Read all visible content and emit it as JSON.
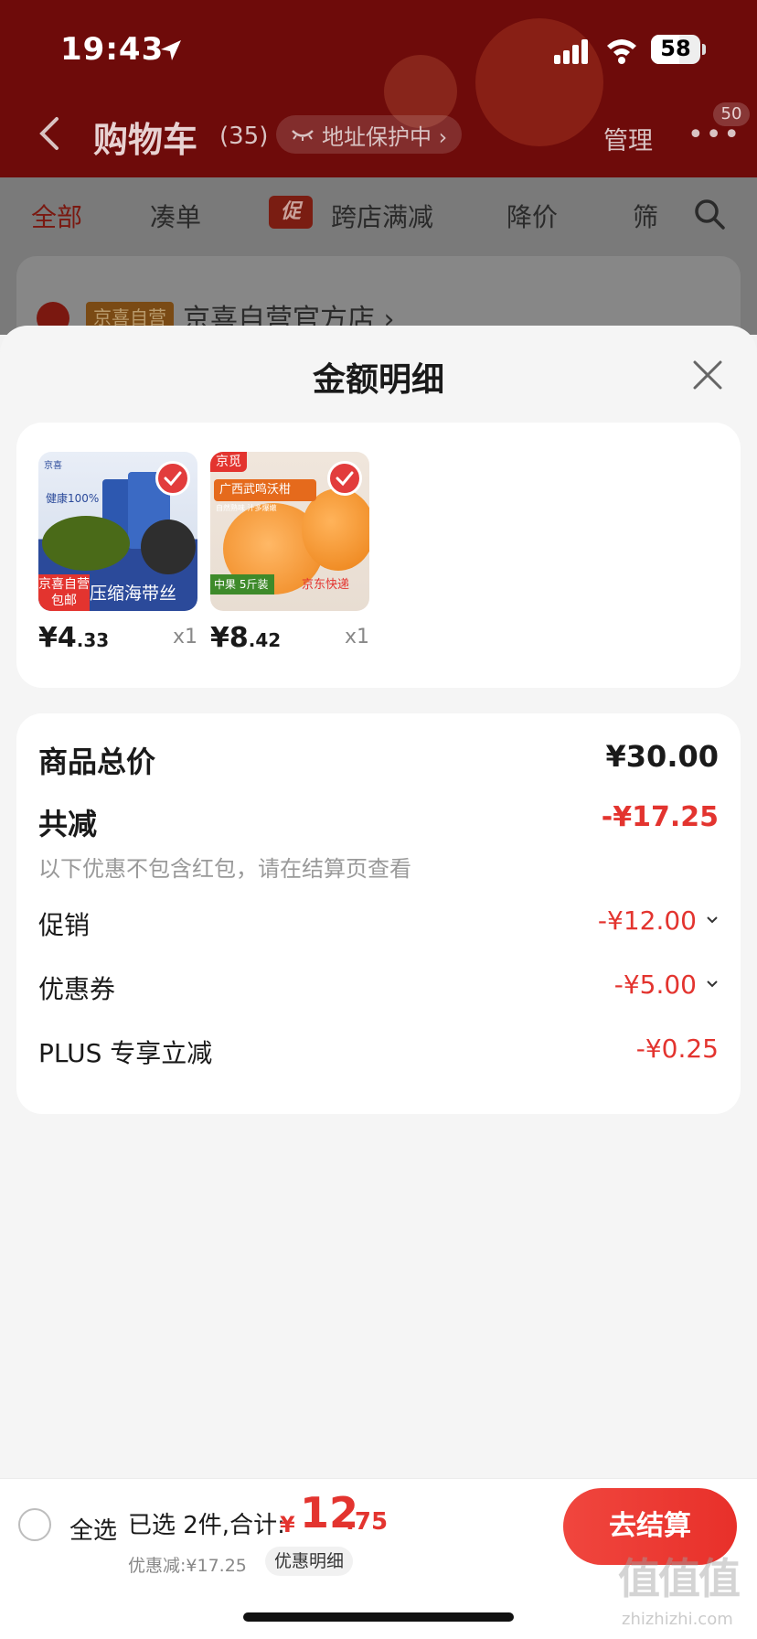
{
  "status_bar": {
    "time": "19:43",
    "battery": "58"
  },
  "nav": {
    "title": "购物车",
    "count": "(35)",
    "address_pill": "地址保护中 ›",
    "manage": "管理",
    "more": "•••",
    "badge": "50"
  },
  "tabs": [
    {
      "label": "全部"
    },
    {
      "label": "凑单"
    },
    {
      "label": "跨店满减",
      "tag": "促"
    },
    {
      "label": "降价"
    },
    {
      "label": "筛"
    }
  ],
  "store": {
    "tag": "京喜自营",
    "name": "京喜自营官方店 ›"
  },
  "sheet": {
    "title": "金额明细"
  },
  "products": [
    {
      "price_int": "¥4",
      "price_dec": ".33",
      "qty": "x1",
      "thumb": {
        "brand": "京喜",
        "claim": "健康100% 杜绝添加",
        "tag_top": "京喜自营",
        "tag_bottom": "包邮",
        "name": "压缩海带丝"
      }
    },
    {
      "price_int": "¥8",
      "price_dec": ".42",
      "qty": "x1",
      "thumb": {
        "brand": "京觅",
        "name": "广西武鸣沃柑",
        "sub": "自然熟味 汁多爆嫩",
        "size": "中果 5斤装",
        "ship": "京东快递"
      }
    }
  ],
  "summary": {
    "total_label": "商品总价",
    "total_value": "¥30.00",
    "minus_label": "共减",
    "minus_value": "-¥17.25",
    "note": "以下优惠不包含红包，请在结算页查看",
    "items": [
      {
        "label": "促销",
        "value": "-¥12.00"
      },
      {
        "label": "优惠券",
        "value": "-¥5.00"
      },
      {
        "label": "PLUS 专享立减",
        "value": "-¥0.25"
      }
    ]
  },
  "bottom": {
    "select_all": "全选",
    "picked": "已选 2件,合计:",
    "yen": "¥",
    "total_int": "12",
    "total_dec": ".75",
    "discount": "优惠减:¥17.25",
    "discount_btn": "优惠明细",
    "checkout": "去结算"
  },
  "watermark": {
    "logo": "值值值",
    "domain": "zhizhizhi.com"
  },
  "colors": {
    "header": "#6e0b0a",
    "accent": "#e3342f"
  }
}
